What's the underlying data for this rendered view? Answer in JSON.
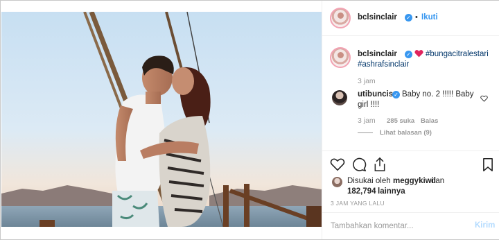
{
  "post": {
    "username": "bclsinclair",
    "verified": true,
    "follow_label": "Ikuti",
    "separator": "•"
  },
  "caption": {
    "username": "bclsinclair",
    "hashtag1": "#bungacitralestari",
    "hashtag2": "#ashrafsinclair",
    "time": "3 jam"
  },
  "comment": {
    "username": "utibuncis",
    "text_line1": "Baby no. 2 !!!!! Baby",
    "text_line2": "girl !!!!",
    "time": "3 jam",
    "likes": "285 suka",
    "reply_label": "Balas",
    "view_replies": "Lihat balasan (9)"
  },
  "likes": {
    "prefix": "Disukai oleh",
    "liker": "meggykiwil",
    "conj": "dan",
    "count": "182,794",
    "suffix": "lainnya"
  },
  "timestamp": "3 JAM YANG LALU",
  "add_comment": {
    "placeholder": "Tambahkan komentar...",
    "post_label": "Kirim"
  },
  "colors": {
    "link": "#3897f0",
    "hashtag": "#003569",
    "heart_emoji": "#e0245e",
    "muted": "#999999"
  },
  "icons": [
    "verified-badge-icon",
    "red-heart-icon",
    "like-heart-icon",
    "comment-icon",
    "share-icon",
    "bookmark-icon",
    "small-like-icon"
  ]
}
